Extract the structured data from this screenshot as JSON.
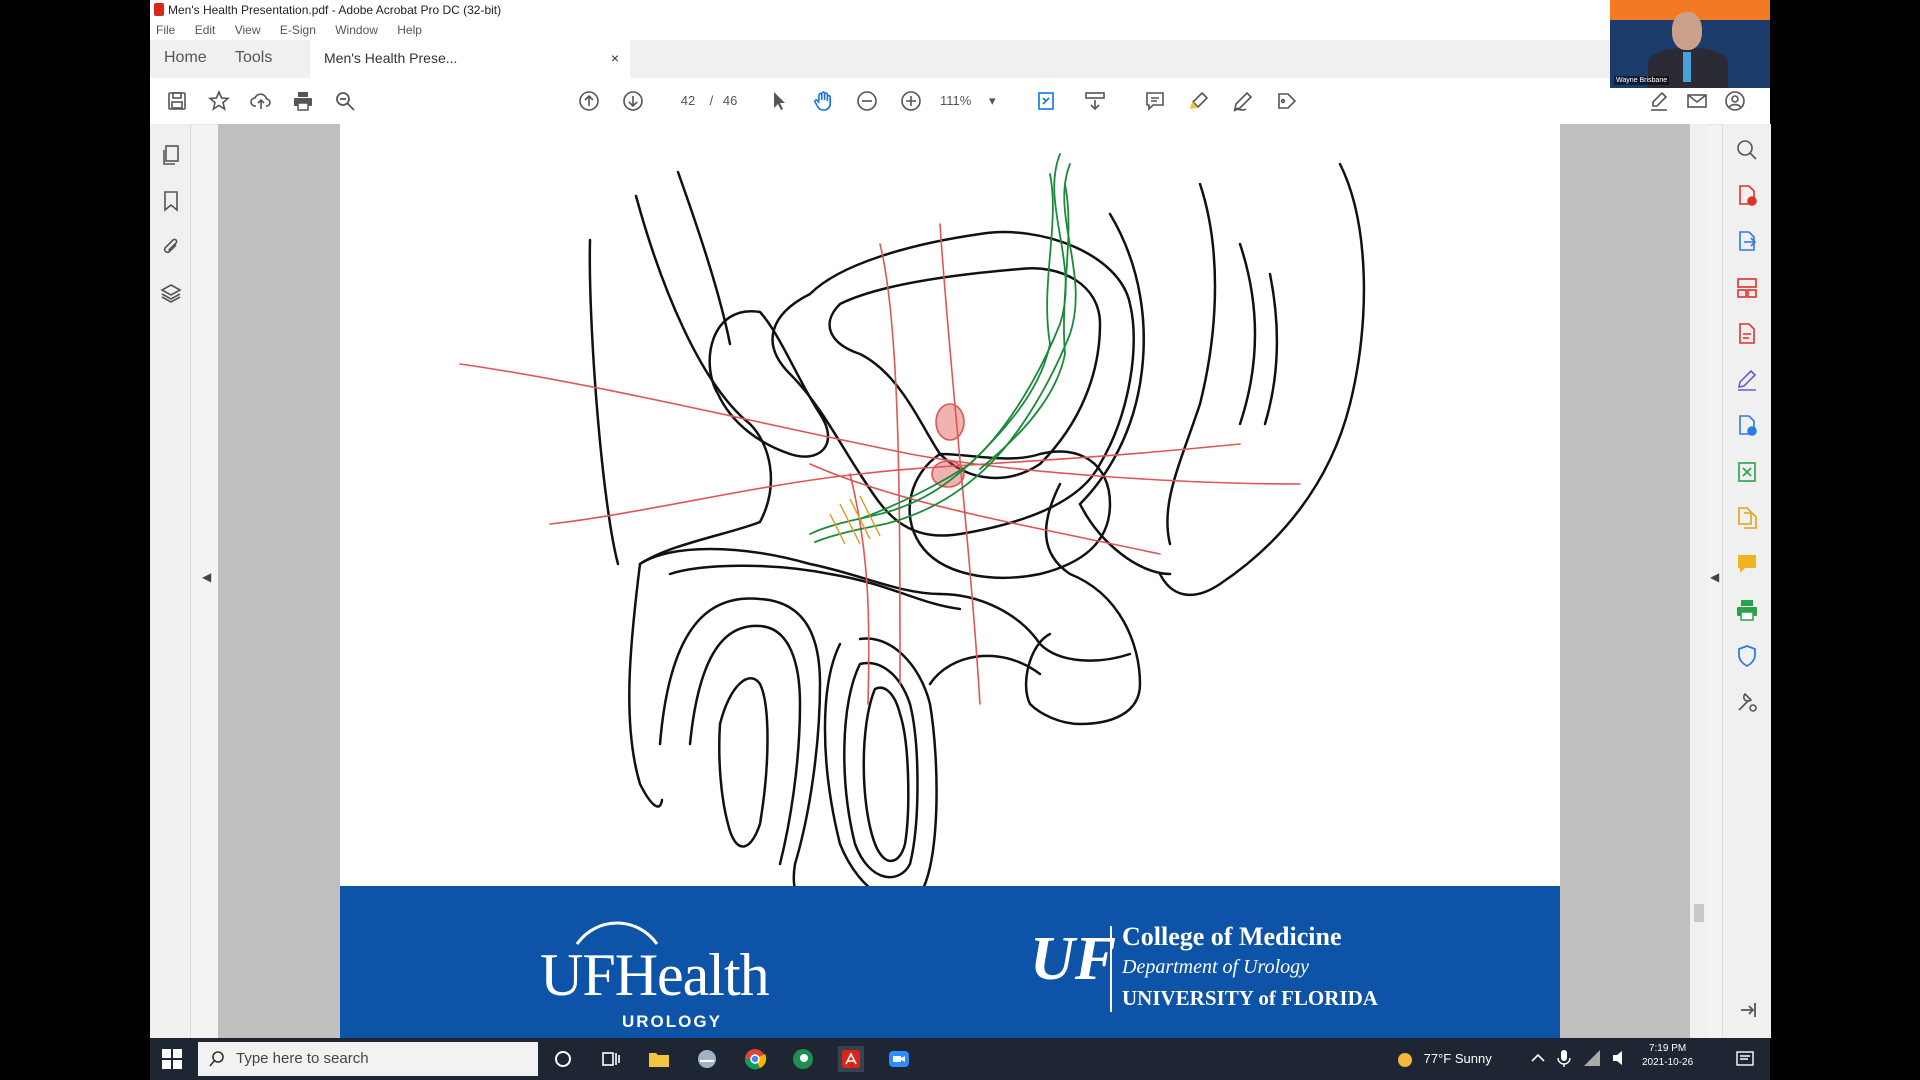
{
  "window": {
    "title": "Men's Health Presentation.pdf - Adobe Acrobat Pro DC (32-bit)"
  },
  "menu": [
    "File",
    "Edit",
    "View",
    "E-Sign",
    "Window",
    "Help"
  ],
  "tabs": {
    "home": "Home",
    "tools": "Tools",
    "doc": "Men's Health Prese...",
    "doc_close": "×"
  },
  "toolbar": {
    "page_current": "42",
    "page_sep": "/",
    "page_total": "46",
    "zoom": "111%",
    "zoom_arrow": "▾"
  },
  "slide": {
    "logo_left_main": "UFHealth",
    "logo_left_sub": "UROLOGY",
    "uf_mark": "UF",
    "college": "College of Medicine",
    "department": "Department of Urology",
    "university": "UNIVERSITY of FLORIDA",
    "ink_colors": {
      "black": "#111111",
      "red": "#e05555",
      "green": "#1a8a3a",
      "orange": "#e39a2b"
    }
  },
  "video": {
    "name": "Wayne Brisbane"
  },
  "taskbar": {
    "search_placeholder": "Type here to search",
    "weather": "77°F  Sunny",
    "time": "7:19 PM",
    "date": "2021-10-26"
  },
  "colors": {
    "footer_blue": "#0d53a8",
    "taskbar": "#1f2633",
    "acrobat_red": "#d9261c"
  }
}
